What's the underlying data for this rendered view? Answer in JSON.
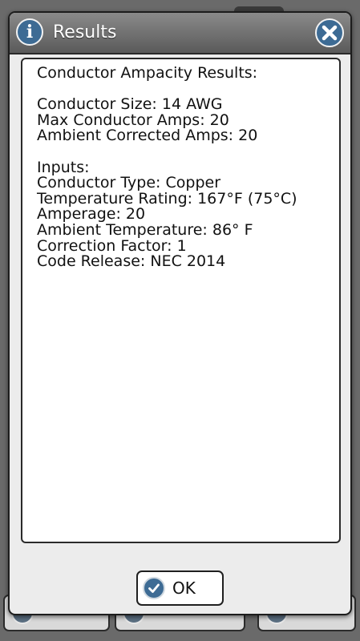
{
  "dialog": {
    "title": "Results",
    "info_icon": "info-icon",
    "close_icon": "close-icon",
    "ok_label": "OK",
    "ok_icon": "check-icon"
  },
  "results": {
    "heading": "Conductor Ampacity Results:",
    "conductor_size": "Conductor Size: 14 AWG",
    "max_conductor_amps": "Max Conductor Amps: 20",
    "ambient_corrected_amps": "Ambient Corrected Amps: 20",
    "inputs_heading": "Inputs:",
    "conductor_type": "Conductor Type: Copper",
    "temperature_rating": "Temperature Rating: 167°F (75°C)",
    "amperage": "Amperage: 20",
    "ambient_temperature": "Ambient Temperature: 86° F",
    "correction_factor": "Correction Factor: 1",
    "code_release": "Code Release: NEC 2014"
  },
  "colors": {
    "accent": "#3d6b94",
    "titlebar": "#6e6e6e",
    "dialog_bg": "#ececec"
  }
}
